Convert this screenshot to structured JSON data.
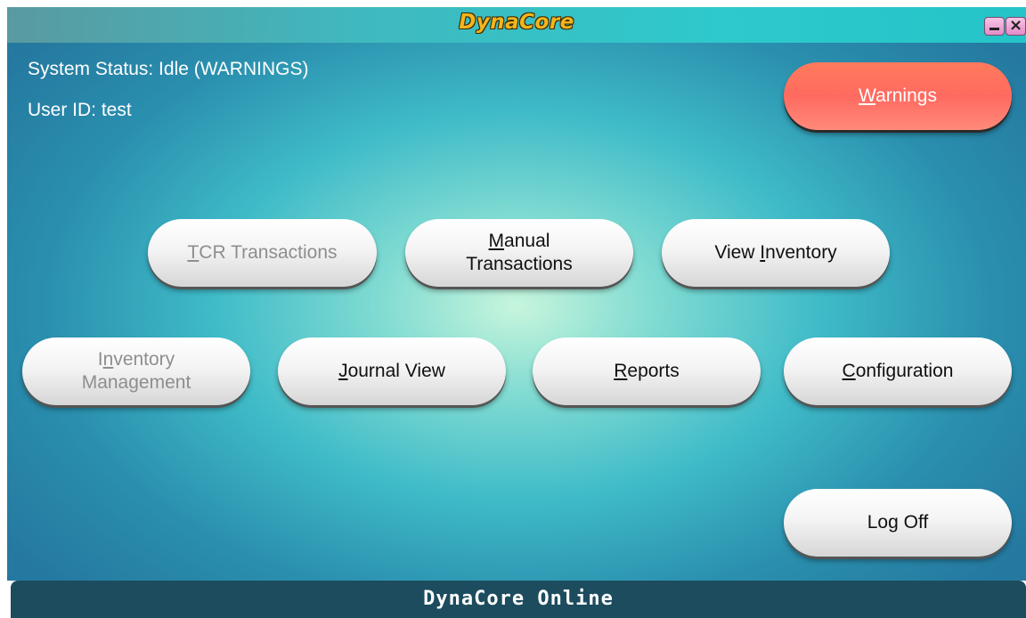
{
  "window": {
    "title": "DynaCore",
    "minimize_icon": "minimize-icon",
    "close_icon": "close-icon",
    "close_glyph": "×"
  },
  "status": {
    "system_status": "System Status: Idle (WARNINGS)",
    "user_id": "User ID: test"
  },
  "buttons": {
    "warnings": {
      "mnemonic": "W",
      "rest": "arnings"
    },
    "tcr_transactions": {
      "mnemonic": "T",
      "rest": "CR Transactions",
      "enabled": false
    },
    "manual_transactions": {
      "line1_mnemonic": "M",
      "line1_rest": "anual",
      "line2": "Transactions"
    },
    "view_inventory": {
      "pre": "View ",
      "mnemonic": "I",
      "rest": "nventory"
    },
    "inventory_management": {
      "line1_pre": "I",
      "line1_mnemonic": "n",
      "line1_rest": "ventory",
      "line2": "Management",
      "enabled": false
    },
    "journal_view": {
      "mnemonic": "J",
      "rest": "ournal View"
    },
    "reports": {
      "mnemonic": "R",
      "rest": "eports"
    },
    "configuration": {
      "mnemonic": "C",
      "rest": "onfiguration"
    },
    "log_off": {
      "label": "Log Off"
    }
  },
  "footer": {
    "text": "DynaCore Online"
  },
  "colors": {
    "warning_button": "#ff6a60",
    "footer_bg": "#1c4c5e",
    "title_text": "#f2b51e"
  }
}
